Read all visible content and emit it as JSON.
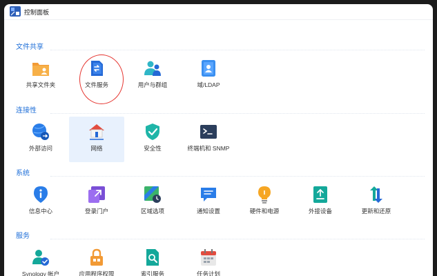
{
  "window": {
    "title": "控制面板"
  },
  "sections": {
    "file_sharing": {
      "title": "文件共享",
      "items": [
        {
          "label": "共享文件夹",
          "icon": "shared-folder-icon"
        },
        {
          "label": "文件服务",
          "icon": "file-services-icon"
        },
        {
          "label": "用户与群组",
          "icon": "user-group-icon"
        },
        {
          "label": "域/LDAP",
          "icon": "domain-ldap-icon"
        }
      ]
    },
    "connectivity": {
      "title": "连接性",
      "items": [
        {
          "label": "外部访问",
          "icon": "external-access-icon"
        },
        {
          "label": "网络",
          "icon": "network-icon",
          "selected": true
        },
        {
          "label": "安全性",
          "icon": "security-shield-icon"
        },
        {
          "label": "终端机和 SNMP",
          "icon": "terminal-icon"
        }
      ]
    },
    "system": {
      "title": "系统",
      "items": [
        {
          "label": "信息中心",
          "icon": "info-center-icon"
        },
        {
          "label": "登录门户",
          "icon": "login-portal-icon"
        },
        {
          "label": "区域选项",
          "icon": "regional-options-icon"
        },
        {
          "label": "通知设置",
          "icon": "notification-icon"
        },
        {
          "label": "硬件和电源",
          "icon": "hardware-power-icon"
        },
        {
          "label": "外接设备",
          "icon": "external-devices-icon"
        },
        {
          "label": "更新和还原",
          "icon": "update-restore-icon"
        }
      ]
    },
    "services": {
      "title": "服务",
      "items": [
        {
          "label": "Synology 帐户",
          "icon": "synology-account-icon"
        },
        {
          "label": "应用程序权限",
          "icon": "app-privileges-icon"
        },
        {
          "label": "索引服务",
          "icon": "indexing-service-icon"
        },
        {
          "label": "任务计划",
          "icon": "task-scheduler-icon"
        }
      ]
    }
  },
  "colors": {
    "accent": "#1f6fd8",
    "selected_bg": "#e8f1fd",
    "highlight_ring": "#e5322d"
  }
}
